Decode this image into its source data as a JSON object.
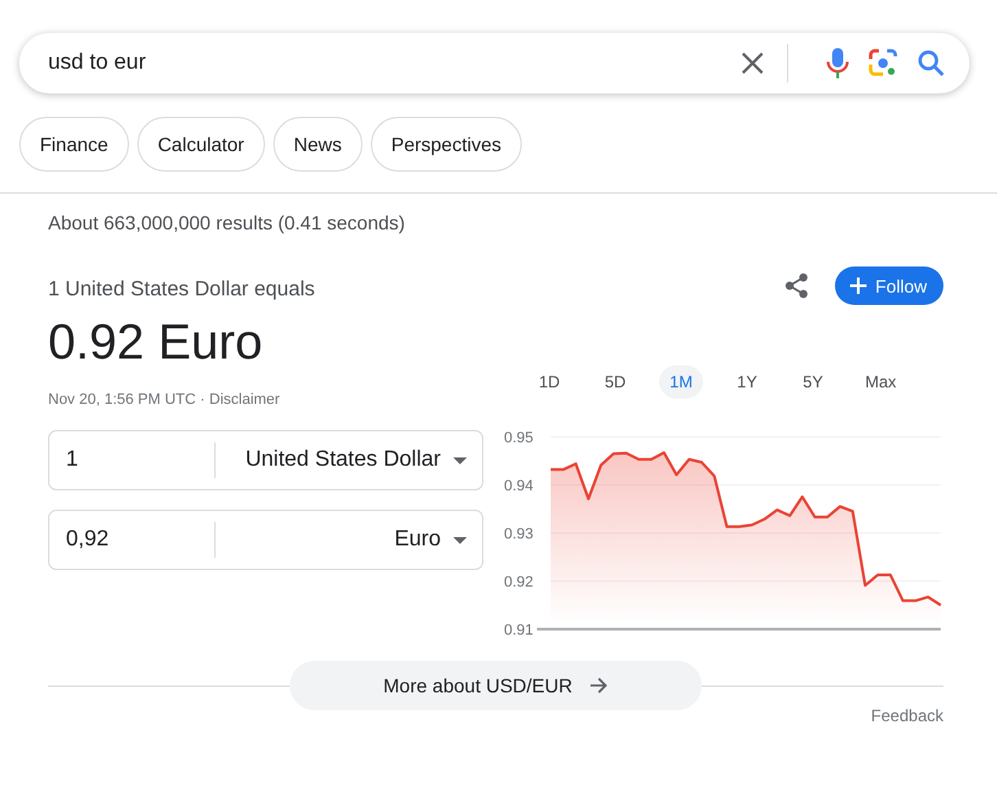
{
  "search": {
    "value": "usd to eur"
  },
  "chips": [
    {
      "label": "Finance"
    },
    {
      "label": "Calculator"
    },
    {
      "label": "News"
    },
    {
      "label": "Perspectives"
    }
  ],
  "result_stats": "About 663,000,000 results (0.41 seconds)",
  "converter": {
    "heading": "1 United States Dollar equals",
    "result": "0.92 Euro",
    "timestamp": "Nov 20, 1:56 PM UTC · ",
    "disclaimer": "Disclaimer",
    "rows": [
      {
        "amount": "1",
        "currency": "United States Dollar"
      },
      {
        "amount": "0,92",
        "currency": "Euro"
      }
    ]
  },
  "follow_button": "Follow",
  "ranges": [
    {
      "label": "1D",
      "selected": false
    },
    {
      "label": "5D",
      "selected": false
    },
    {
      "label": "1M",
      "selected": true
    },
    {
      "label": "1Y",
      "selected": false
    },
    {
      "label": "5Y",
      "selected": false
    },
    {
      "label": "Max",
      "selected": false
    }
  ],
  "chart": {
    "chart_data": {
      "type": "area",
      "grid": true,
      "ylim": [
        0.91,
        0.95
      ],
      "yticks": [
        {
          "value": 0.91,
          "label": "0.91"
        },
        {
          "value": 0.92,
          "label": "0.92"
        },
        {
          "value": 0.93,
          "label": "0.93"
        },
        {
          "value": 0.94,
          "label": "0.94"
        },
        {
          "value": 0.95,
          "label": "0.95"
        }
      ],
      "series": [
        {
          "color": "#ea4335",
          "values": [
            0.9432,
            0.9432,
            0.9444,
            0.9371,
            0.9441,
            0.9465,
            0.9466,
            0.9453,
            0.9453,
            0.9467,
            0.9421,
            0.9453,
            0.9447,
            0.9419,
            0.9313,
            0.9313,
            0.9317,
            0.9329,
            0.9348,
            0.9336,
            0.9375,
            0.9333,
            0.9333,
            0.9355,
            0.9345,
            0.9191,
            0.9213,
            0.9213,
            0.9159,
            0.9159,
            0.9167,
            0.915
          ]
        }
      ]
    }
  },
  "more_button": "More about USD/EUR",
  "feedback": "Feedback"
}
